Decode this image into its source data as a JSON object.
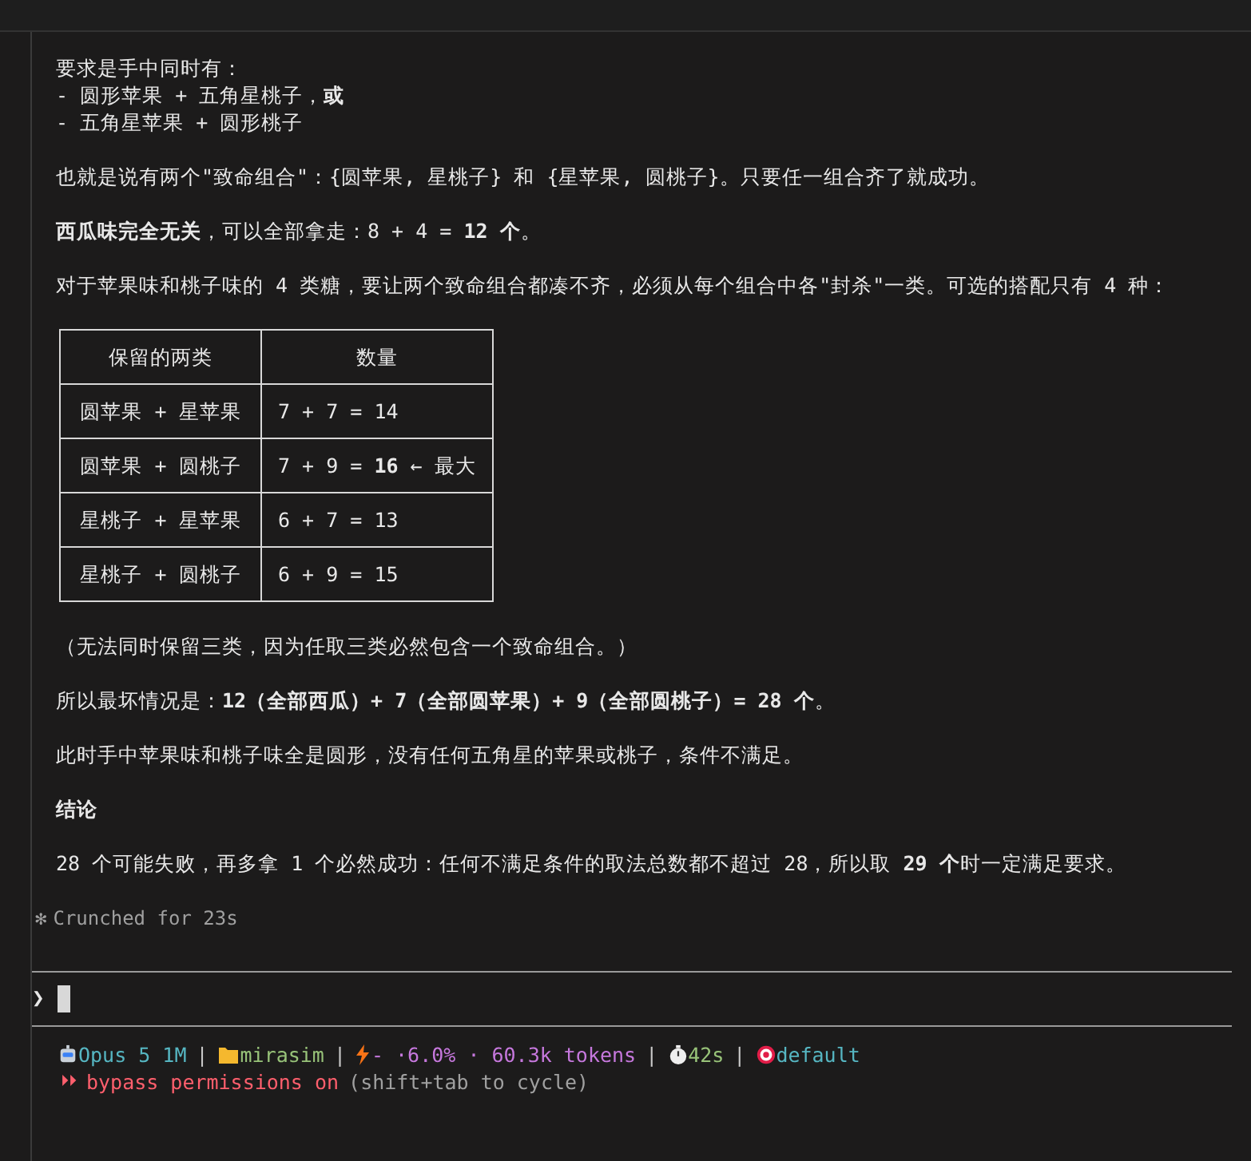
{
  "blocks": [
    {
      "kind": "paragraph",
      "lines": [
        "要求是手中同时有：",
        "- 圆形苹果 + 五角星桃子，**或**",
        "- 五角星苹果 + 圆形桃子"
      ]
    },
    {
      "kind": "paragraph",
      "lines": [
        "也就是说有两个\"致命组合\"：{圆苹果, 星桃子} 和 {星苹果, 圆桃子}。只要任一组合齐了就成功。"
      ]
    },
    {
      "kind": "paragraph",
      "lines": [
        "**西瓜味完全无关**，可以全部拿走：8 + 4 = **12 个**。"
      ]
    },
    {
      "kind": "paragraph",
      "lines": [
        "对于苹果味和桃子味的 4 类糖，要让两个致命组合都凑不齐，必须从每个组合中各\"封杀\"一类。可选的搭配只有 4 种："
      ]
    },
    {
      "kind": "table",
      "columns": [
        "保留的两类",
        "数量"
      ],
      "rows": [
        [
          "圆苹果 + 星苹果",
          "7 + 7 = 14"
        ],
        [
          "圆苹果 + 圆桃子",
          "7 + 9 = **16** ← 最大"
        ],
        [
          "星桃子 + 星苹果",
          "6 + 7 = 13"
        ],
        [
          "星桃子 + 圆桃子",
          "6 + 9 = 15"
        ]
      ]
    },
    {
      "kind": "paragraph",
      "lines": [
        "（无法同时保留三类，因为任取三类必然包含一个致命组合。）"
      ]
    },
    {
      "kind": "paragraph",
      "lines": [
        "所以最坏情况是：**12（全部西瓜）+ 7（全部圆苹果）+ 9（全部圆桃子）= 28 个**。"
      ]
    },
    {
      "kind": "paragraph",
      "lines": [
        "此时手中苹果味和桃子味全是圆形，没有任何五角星的苹果或桃子，条件不满足。"
      ]
    },
    {
      "kind": "heading",
      "lines": [
        "结论"
      ]
    },
    {
      "kind": "paragraph",
      "lines": [
        "28 个可能失败，再多拿 1 个必然成功：任何不满足条件的取法总数都不超过 28，所以取 **29 个**时一定满足要求。"
      ]
    }
  ],
  "status_note": {
    "symbol": "✻",
    "text": "Crunched for 23s"
  },
  "prompt": {
    "symbol": "❯"
  },
  "status_line": [
    {
      "text": "Opus 5 1M",
      "color": "#56b6c2"
    },
    {
      "text": "|",
      "color": "#c8c8c8"
    },
    {
      "text": "mirasim",
      "color": "#98c379"
    },
    {
      "text": "|",
      "color": "#c8c8c8"
    },
    {
      "text": "- ·6.0% · 60.3k tokens",
      "color": "#c678dd"
    },
    {
      "text": "|",
      "color": "#c8c8c8"
    },
    {
      "text": "42s",
      "color": "#98c379"
    },
    {
      "text": "|",
      "color": "#c8c8c8"
    },
    {
      "text": "default",
      "color": "#56b6c2"
    }
  ],
  "mode_line": {
    "symbol": "⏵⏵",
    "text": "bypass permissions on",
    "hint": "(shift+tab to cycle)"
  }
}
